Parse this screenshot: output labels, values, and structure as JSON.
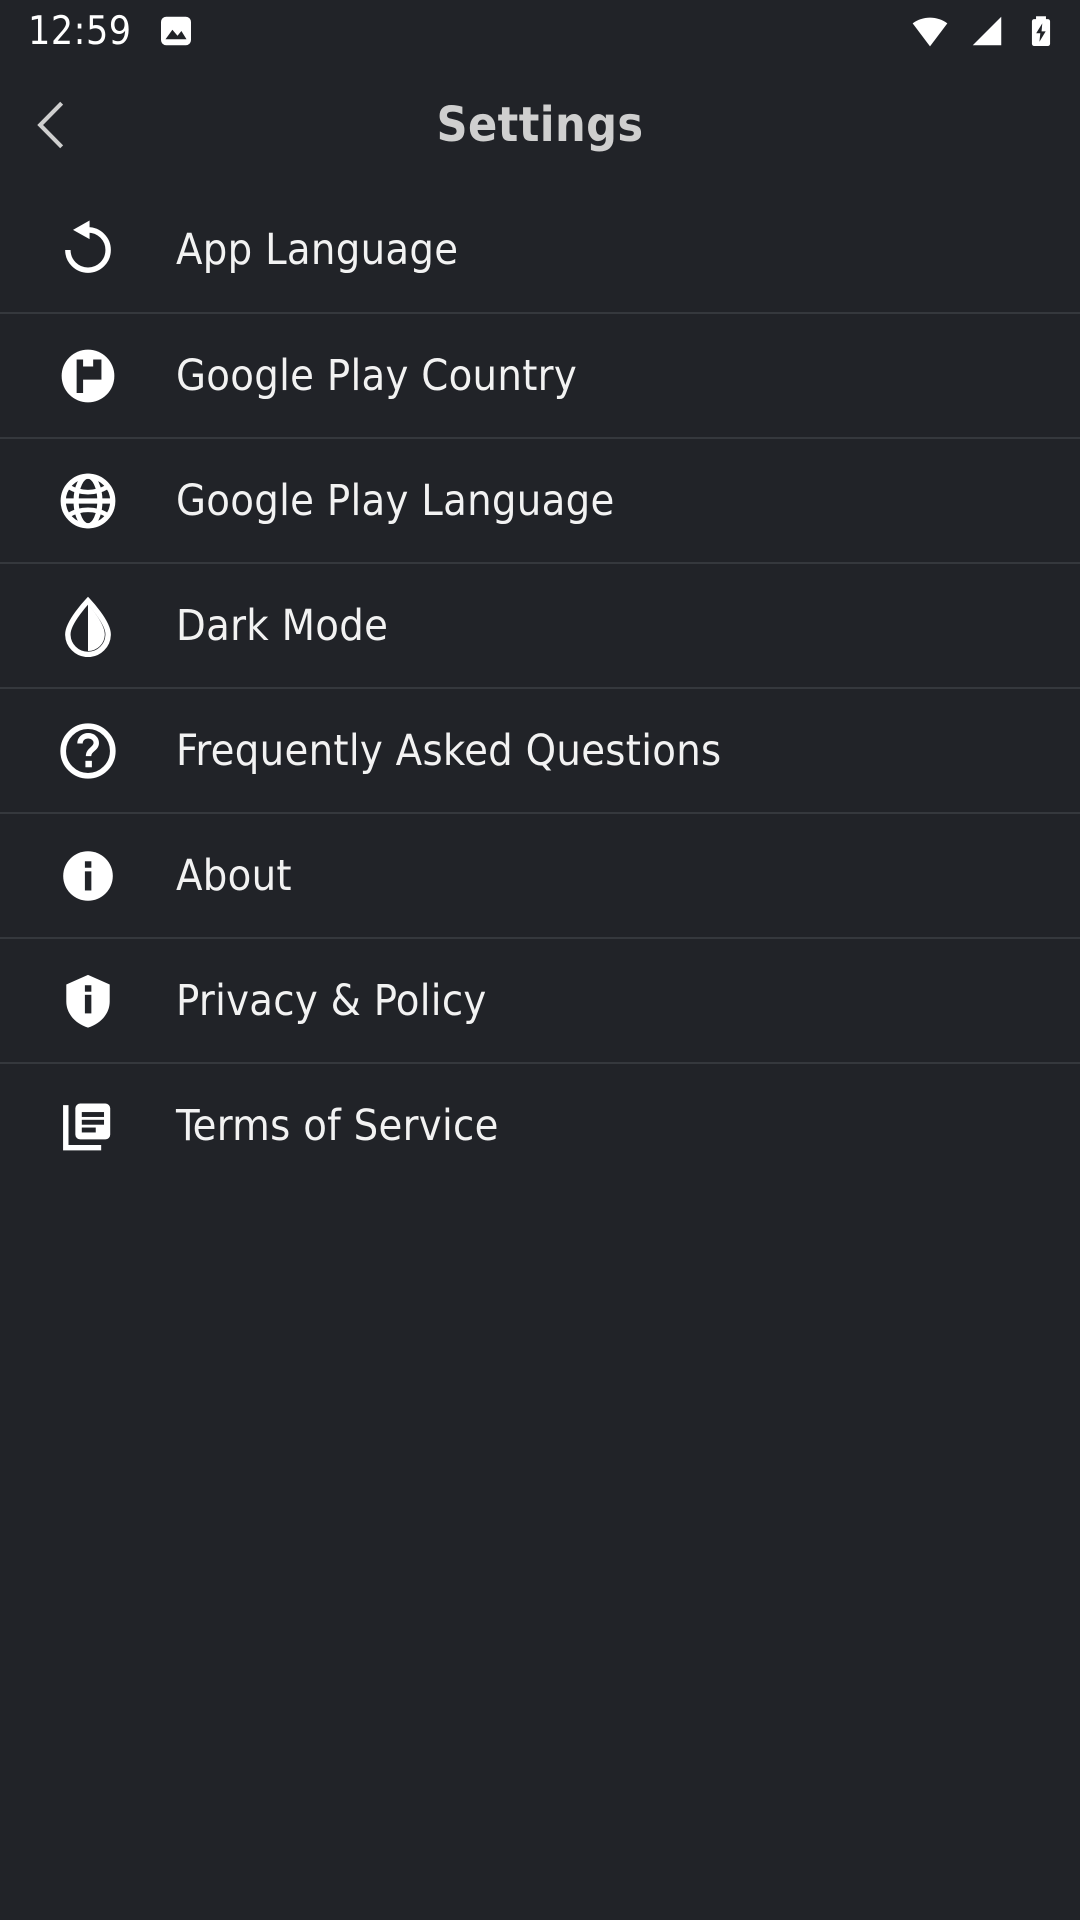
{
  "status_bar": {
    "time": "12:59",
    "icons": [
      "photo-icon",
      "wifi-icon",
      "cellular-signal-icon",
      "battery-charging-icon"
    ]
  },
  "header": {
    "title": "Settings",
    "back_icon": "chevron-left-icon"
  },
  "colors": {
    "background": "#212328",
    "divider": "#35383d",
    "label": "#f2f2f2",
    "title": "#cfcfcf",
    "icon": "#ffffff"
  },
  "settings_list": [
    {
      "label": "App Language",
      "icon": "rotate-arrow-icon"
    },
    {
      "label": "Google Play Country",
      "icon": "flag-circle-icon"
    },
    {
      "label": "Google Play Language",
      "icon": "globe-icon"
    },
    {
      "label": "Dark Mode",
      "icon": "half-filled-droplet-icon"
    },
    {
      "label": "Frequently Asked Questions",
      "icon": "question-circle-icon"
    },
    {
      "label": "About",
      "icon": "info-circle-icon"
    },
    {
      "label": "Privacy & Policy",
      "icon": "shield-info-icon"
    },
    {
      "label": "Terms of Service",
      "icon": "documents-icon"
    }
  ]
}
